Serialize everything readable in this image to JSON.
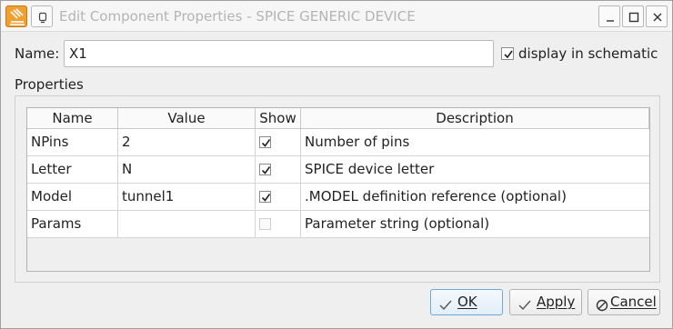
{
  "window": {
    "title": "Edit Component Properties - SPICE GENERIC DEVICE"
  },
  "form": {
    "name_label": "Name:",
    "name_value": "X1",
    "display_in_schematic_label": "display in schematic",
    "display_in_schematic_checked": true,
    "properties_label": "Properties"
  },
  "table": {
    "columns": [
      "Name",
      "Value",
      "Show",
      "Description"
    ],
    "rows": [
      {
        "name": "NPins",
        "value": "2",
        "show": true,
        "description": "Number of pins"
      },
      {
        "name": "Letter",
        "value": "N",
        "show": true,
        "description": "SPICE device letter"
      },
      {
        "name": "Model",
        "value": "tunnel1",
        "show": true,
        "description": ".MODEL definition reference (optional)"
      },
      {
        "name": "Params",
        "value": "",
        "show": false,
        "description": "Parameter string (optional)"
      }
    ]
  },
  "buttons": {
    "ok": "OK",
    "apply": "Apply",
    "cancel": "Cancel"
  },
  "icons": {
    "app": "qucs-app-icon",
    "pin": "pin-icon",
    "minimize": "minimize-icon",
    "maximize": "maximize-icon",
    "close": "close-icon",
    "ok": "check-icon",
    "apply": "check-icon",
    "cancel": "cancel-icon"
  },
  "colors": {
    "accent": "#6aa9d8",
    "app_icon": "#f0a030"
  }
}
